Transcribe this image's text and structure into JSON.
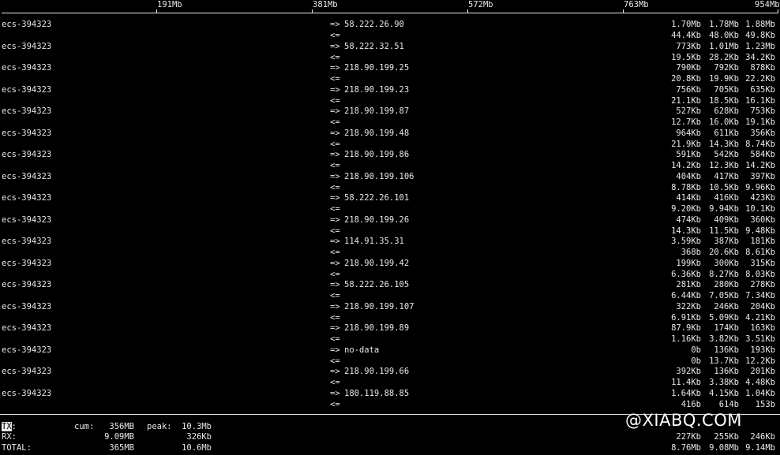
{
  "scale": {
    "ticks": [
      "191Mb",
      "381Mb",
      "572Mb",
      "763Mb",
      "954Mb"
    ]
  },
  "hosts": [
    {
      "src": "ecs-394323",
      "dst": "58.222.26.90",
      "out": [
        "1.70Mb",
        "1.78Mb",
        "1.88Mb"
      ],
      "in": [
        "44.4Kb",
        "48.0Kb",
        "49.8Kb"
      ]
    },
    {
      "src": "ecs-394323",
      "dst": "58.222.32.51",
      "out": [
        "773Kb",
        "1.01Mb",
        "1.23Mb"
      ],
      "in": [
        "19.5Kb",
        "28.2Kb",
        "34.2Kb"
      ]
    },
    {
      "src": "ecs-394323",
      "dst": "218.90.199.25",
      "out": [
        "790Kb",
        "792Kb",
        "878Kb"
      ],
      "in": [
        "20.8Kb",
        "19.9Kb",
        "22.2Kb"
      ]
    },
    {
      "src": "ecs-394323",
      "dst": "218.90.199.23",
      "out": [
        "756Kb",
        "705Kb",
        "635Kb"
      ],
      "in": [
        "21.1Kb",
        "18.5Kb",
        "16.1Kb"
      ]
    },
    {
      "src": "ecs-394323",
      "dst": "218.90.199.87",
      "out": [
        "527Kb",
        "628Kb",
        "753Kb"
      ],
      "in": [
        "12.7Kb",
        "16.0Kb",
        "19.1Kb"
      ]
    },
    {
      "src": "ecs-394323",
      "dst": "218.90.199.48",
      "out": [
        "964Kb",
        "611Kb",
        "356Kb"
      ],
      "in": [
        "21.9Kb",
        "14.3Kb",
        "8.74Kb"
      ]
    },
    {
      "src": "ecs-394323",
      "dst": "218.90.199.86",
      "out": [
        "591Kb",
        "542Kb",
        "584Kb"
      ],
      "in": [
        "14.2Kb",
        "12.3Kb",
        "14.2Kb"
      ]
    },
    {
      "src": "ecs-394323",
      "dst": "218.90.199.106",
      "out": [
        "404Kb",
        "417Kb",
        "397Kb"
      ],
      "in": [
        "8.78Kb",
        "10.5Kb",
        "9.96Kb"
      ]
    },
    {
      "src": "ecs-394323",
      "dst": "58.222.26.101",
      "out": [
        "414Kb",
        "416Kb",
        "423Kb"
      ],
      "in": [
        "9.20Kb",
        "9.94Kb",
        "10.1Kb"
      ]
    },
    {
      "src": "ecs-394323",
      "dst": "218.90.199.26",
      "out": [
        "474Kb",
        "409Kb",
        "360Kb"
      ],
      "in": [
        "14.3Kb",
        "11.5Kb",
        "9.48Kb"
      ]
    },
    {
      "src": "ecs-394323",
      "dst": "114.91.35.31",
      "out": [
        "3.59Kb",
        "387Kb",
        "181Kb"
      ],
      "in": [
        "368b",
        "20.6Kb",
        "8.61Kb"
      ]
    },
    {
      "src": "ecs-394323",
      "dst": "218.90.199.42",
      "out": [
        "199Kb",
        "300Kb",
        "315Kb"
      ],
      "in": [
        "6.36Kb",
        "8.27Kb",
        "8.03Kb"
      ]
    },
    {
      "src": "ecs-394323",
      "dst": "58.222.26.105",
      "out": [
        "281Kb",
        "280Kb",
        "278Kb"
      ],
      "in": [
        "6.44Kb",
        "7.05Kb",
        "7.34Kb"
      ]
    },
    {
      "src": "ecs-394323",
      "dst": "218.90.199.107",
      "out": [
        "322Kb",
        "246Kb",
        "204Kb"
      ],
      "in": [
        "6.91Kb",
        "5.09Kb",
        "4.21Kb"
      ]
    },
    {
      "src": "ecs-394323",
      "dst": "218.90.199.89",
      "out": [
        "87.9Kb",
        "174Kb",
        "163Kb"
      ],
      "in": [
        "1.16Kb",
        "3.82Kb",
        "3.51Kb"
      ]
    },
    {
      "src": "ecs-394323",
      "dst": "no-data",
      "out": [
        "0b",
        "136Kb",
        "193Kb"
      ],
      "in": [
        "0b",
        "13.7Kb",
        "12.2Kb"
      ]
    },
    {
      "src": "ecs-394323",
      "dst": "218.90.199.66",
      "out": [
        "392Kb",
        "136Kb",
        "201Kb"
      ],
      "in": [
        "11.4Kb",
        "3.38Kb",
        "4.48Kb"
      ]
    },
    {
      "src": "ecs-394323",
      "dst": "180.119.88.85",
      "out": [
        "1.64Kb",
        "4.15Kb",
        "1.04Kb"
      ],
      "in": [
        "416b",
        "614b",
        "153b"
      ]
    }
  ],
  "arrows": {
    "out": "=>",
    "in": "<="
  },
  "totals": {
    "tx": {
      "label": "TX:",
      "cum_label": "cum:",
      "cum": "356MB",
      "peak_label": "peak:",
      "peak": "10.3Mb",
      "rates": [
        "",
        "",
        ""
      ]
    },
    "rx": {
      "label": "RX:",
      "cum": "9.09MB",
      "peak": "326Kb",
      "rates": [
        "227Kb",
        "255Kb",
        "246Kb"
      ]
    },
    "total": {
      "label": "TOTAL:",
      "cum": "365MB",
      "peak": "10.6Mb",
      "rates": [
        "8.76Mb",
        "9.08Mb",
        "9.14Mb"
      ]
    }
  },
  "watermark": "@XIABQ.COM"
}
